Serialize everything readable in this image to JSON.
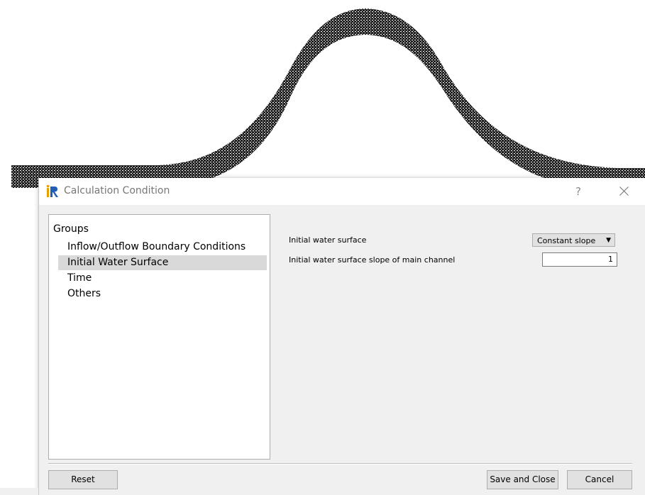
{
  "dialog": {
    "title": "Calculation Condition",
    "help": "?",
    "close_icon": "close-icon",
    "app_icon": "iric-logo-icon"
  },
  "groups": {
    "header": "Groups",
    "items": [
      {
        "label": "Inflow/Outflow Boundary Conditions",
        "selected": false
      },
      {
        "label": "Initial Water Surface",
        "selected": true
      },
      {
        "label": "Time",
        "selected": false
      },
      {
        "label": "Others",
        "selected": false
      }
    ]
  },
  "form": {
    "water_surface_label": "Initial water surface",
    "water_surface_value": "Constant slope",
    "slope_label": "Initial water surface slope of main channel",
    "slope_value": "1"
  },
  "buttons": {
    "reset": "Reset",
    "save_close": "Save and Close",
    "cancel": "Cancel"
  },
  "colors": {
    "dialog_bg": "#f0f0f0",
    "selected_bg": "#d9d9d9",
    "mesh": "#000000"
  }
}
